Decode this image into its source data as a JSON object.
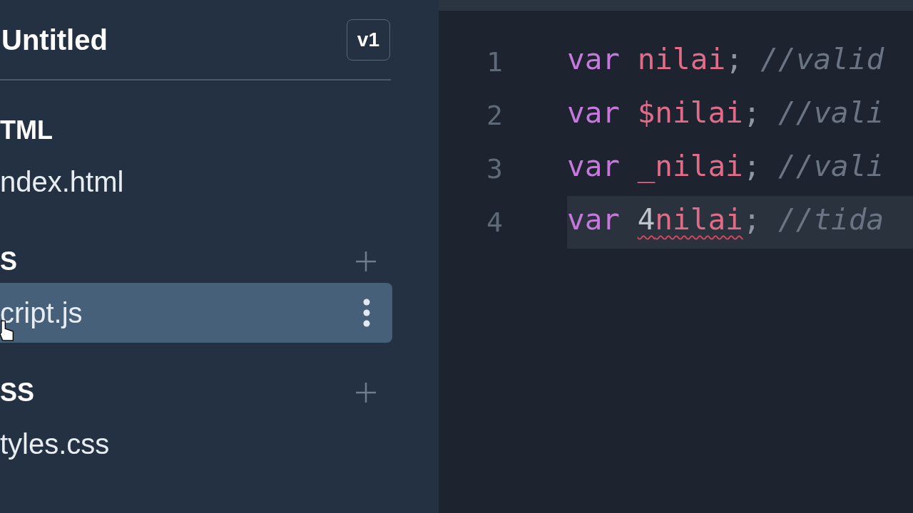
{
  "project": {
    "title": "Untitled",
    "version": "v1"
  },
  "sections": [
    {
      "label": "TML",
      "can_add": false,
      "files": [
        {
          "name": "ndex.html",
          "selected": false
        }
      ]
    },
    {
      "label": "S",
      "can_add": true,
      "files": [
        {
          "name": "cript.js",
          "selected": true
        }
      ]
    },
    {
      "label": "SS",
      "can_add": true,
      "files": [
        {
          "name": "tyles.css",
          "selected": false
        }
      ]
    }
  ],
  "editor": {
    "lines": [
      {
        "number": "1",
        "active": false,
        "tokens": [
          {
            "kind": "keyword",
            "text": "var",
            "error": false
          },
          {
            "kind": "identifier",
            "text": "nilai",
            "error": false
          },
          {
            "kind": "punct",
            "text": ";",
            "error": false
          },
          {
            "kind": "comment",
            "text": "//valid",
            "error": false
          }
        ]
      },
      {
        "number": "2",
        "active": false,
        "tokens": [
          {
            "kind": "keyword",
            "text": "var",
            "error": false
          },
          {
            "kind": "identifier",
            "text": "$nilai",
            "error": false
          },
          {
            "kind": "punct",
            "text": ";",
            "error": false
          },
          {
            "kind": "comment",
            "text": "//vali",
            "error": false
          }
        ]
      },
      {
        "number": "3",
        "active": false,
        "tokens": [
          {
            "kind": "keyword",
            "text": "var",
            "error": false
          },
          {
            "kind": "identifier",
            "text": "_nilai",
            "error": false
          },
          {
            "kind": "punct",
            "text": ";",
            "error": false
          },
          {
            "kind": "comment",
            "text": "//vali",
            "error": false
          }
        ]
      },
      {
        "number": "4",
        "active": true,
        "tokens": [
          {
            "kind": "keyword",
            "text": "var",
            "error": false
          },
          {
            "kind": "number",
            "text": "4",
            "error": true
          },
          {
            "kind": "identifier",
            "text": "nilai",
            "error": true
          },
          {
            "kind": "punct",
            "text": ";",
            "error": false
          },
          {
            "kind": "comment",
            "text": "//tida",
            "error": false
          }
        ]
      }
    ]
  }
}
